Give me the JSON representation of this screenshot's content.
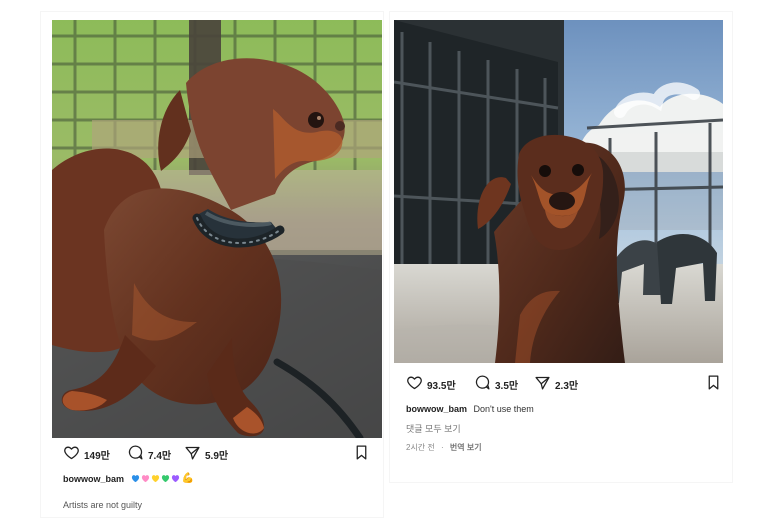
{
  "posts": [
    {
      "likes": "149만",
      "comments": "7.4만",
      "shares": "5.9만",
      "username": "bowwow_bam",
      "caption_emojis": [
        "blue-heart",
        "pink-heart",
        "yellow-heart",
        "green-heart",
        "purple-heart",
        "flexed-biceps"
      ],
      "caption_emoji_text": "💙💗💛💚💜💪",
      "secondary_text": "Artists are not guilty",
      "icon_names": {
        "like": "heart-icon",
        "comment": "comment-icon",
        "share": "send-icon",
        "save": "bookmark-icon"
      }
    },
    {
      "likes": "93.5만",
      "comments": "3.5만",
      "shares": "2.3만",
      "username": "bowwow_bam",
      "caption_text": "Don't use them",
      "view_comments": "댓글 모두 보기",
      "time_ago": "2시간 전",
      "translate_label": "번역 보기",
      "icon_names": {
        "like": "heart-icon",
        "comment": "comment-icon",
        "share": "send-icon",
        "save": "bookmark-icon"
      }
    }
  ],
  "colors": {
    "background": "#ffffff",
    "text": "#222222",
    "muted_text": "#777777",
    "dog_brown": "#6a3a27",
    "dog_tan": "#b85c2d"
  }
}
